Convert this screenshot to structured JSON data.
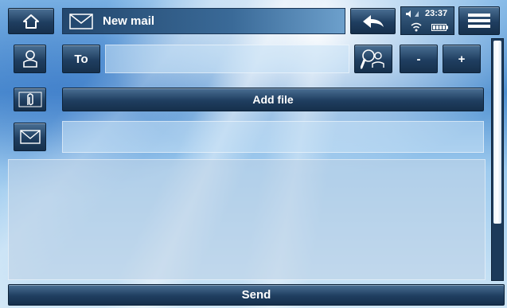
{
  "header": {
    "title": "New mail",
    "time": "23:37",
    "accent": "#1f3e60"
  },
  "form": {
    "to_label": "To",
    "to_value": "",
    "minus_label": "-",
    "plus_label": "+",
    "add_file_label": "Add file",
    "subject_value": "",
    "body_value": ""
  },
  "footer": {
    "send_label": "Send"
  },
  "icons": [
    "home-icon",
    "envelope-icon",
    "back-arrow-icon",
    "volume-icon",
    "wifi-icon",
    "battery-icon",
    "menu-icon",
    "contact-icon",
    "paperclip-icon",
    "search-contact-icon"
  ]
}
